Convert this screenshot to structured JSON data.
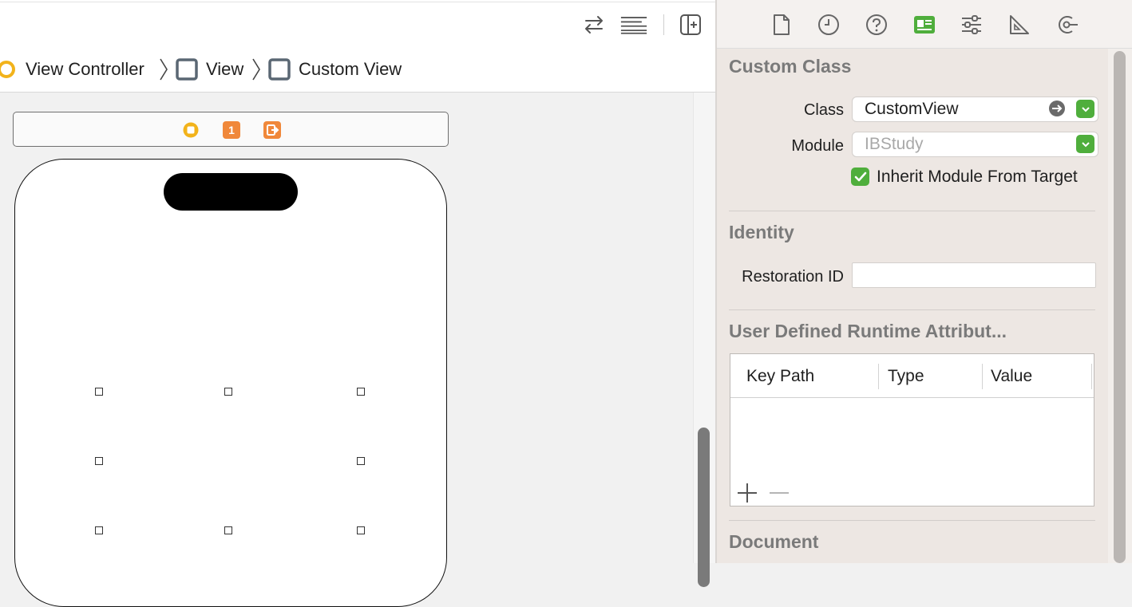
{
  "toolbar": {
    "icons": [
      "swap-arrows-icon",
      "text-lines-icon",
      "add-editor-icon"
    ]
  },
  "jumpbar": {
    "crumbs": [
      "View Controller",
      "View",
      "Custom View"
    ]
  },
  "scene_bar": {
    "icons": [
      "view-controller-icon",
      "first-responder-icon",
      "exit-icon"
    ],
    "first_responder_badge": "1"
  },
  "inspector": {
    "tabs": [
      "file-inspector-icon",
      "history-icon",
      "help-icon",
      "identity-inspector-icon",
      "attributes-inspector-icon",
      "size-inspector-icon",
      "connections-inspector-icon"
    ],
    "custom_class": {
      "title": "Custom Class",
      "class_label": "Class",
      "class_value": "CustomView",
      "module_label": "Module",
      "module_placeholder": "IBStudy",
      "inherit_label": "Inherit Module From Target",
      "inherit_checked": true
    },
    "identity": {
      "title": "Identity",
      "restoration_label": "Restoration ID",
      "restoration_value": ""
    },
    "runtime_attributes": {
      "title": "User Defined Runtime Attribut...",
      "columns": [
        "Key Path",
        "Type",
        "Value"
      ],
      "rows": []
    },
    "document": {
      "title": "Document"
    }
  },
  "colors": {
    "accent_green": "#4fae3c",
    "warning_orange": "#f0883a",
    "controller_yellow": "#f2b31b"
  }
}
